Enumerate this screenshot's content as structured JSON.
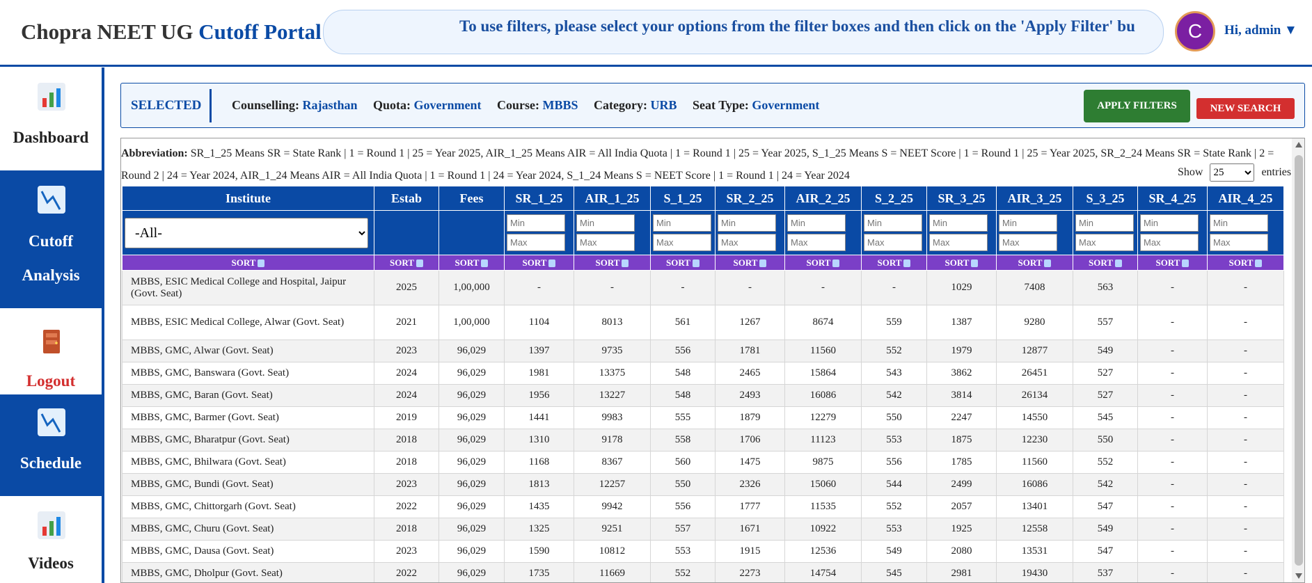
{
  "header": {
    "brand_main": "Chopra NEET UG",
    "brand_accent": "Cutoff Portal",
    "notice": "To use filters, please select your options from the filter boxes and then click on the 'Apply Filter' bu",
    "avatar_letter": "C",
    "greeting": "Hi, admin ▼"
  },
  "sidebar": {
    "items": [
      {
        "label": "Dashboard",
        "icon": "bar-chart-icon"
      },
      {
        "label": "Cutoff",
        "label2": "Analysis",
        "icon": "line-chart-icon"
      },
      {
        "label": "Logout",
        "icon": "door-icon"
      },
      {
        "label": "Schedule",
        "icon": "line-chart-icon"
      },
      {
        "label": "Videos",
        "icon": "bar-chart-icon"
      }
    ]
  },
  "selected": {
    "title": "SELECTED",
    "counselling_label": "Counselling:",
    "counselling": "Rajasthan",
    "quota_label": "Quota:",
    "quota": "Government",
    "course_label": "Course:",
    "course": "MBBS",
    "category_label": "Category:",
    "category": "URB",
    "seat_label": "Seat Type:",
    "seat": "Government",
    "apply": "APPLY FILTERS",
    "new_search": "NEW SEARCH"
  },
  "abbreviation": {
    "label": "Abbreviation:",
    "text": "SR_1_25 Means SR = State Rank | 1 = Round 1 | 25 = Year 2025, AIR_1_25 Means AIR = All India Quota | 1 = Round 1 | 25 = Year 2025, S_1_25 Means S = NEET Score | 1 = Round 1 | 25 = Year 2025, SR_2_24 Means SR = State Rank | 2 = Round 2 | 24 = Year 2024, AIR_1_24 Means AIR = All India Quota | 1 = Round 1 | 24 = Year 2024, S_1_24 Means S = NEET Score | 1 = Round 1 | 24 = Year 2024"
  },
  "show": {
    "label": "Show",
    "value": "25",
    "suffix": "entries"
  },
  "table": {
    "columns": [
      "Institute",
      "Estab",
      "Fees",
      "SR_1_25",
      "AIR_1_25",
      "S_1_25",
      "SR_2_25",
      "AIR_2_25",
      "S_2_25",
      "SR_3_25",
      "AIR_3_25",
      "S_3_25",
      "SR_4_25",
      "AIR_4_25"
    ],
    "institute_filter": "-All-",
    "min_placeholder": "Min",
    "max_placeholder": "Max",
    "sort_label": "SORT",
    "rows": [
      [
        "MBBS, ESIC Medical College and Hospital, Jaipur (Govt. Seat)",
        "2025",
        "1,00,000",
        "-",
        "-",
        "-",
        "-",
        "-",
        "-",
        "1029",
        "7408",
        "563",
        "-",
        "-"
      ],
      [
        "MBBS, ESIC Medical College, Alwar (Govt. Seat)",
        "2021",
        "1,00,000",
        "1104",
        "8013",
        "561",
        "1267",
        "8674",
        "559",
        "1387",
        "9280",
        "557",
        "-",
        "-"
      ],
      [
        "MBBS, GMC, Alwar (Govt. Seat)",
        "2023",
        "96,029",
        "1397",
        "9735",
        "556",
        "1781",
        "11560",
        "552",
        "1979",
        "12877",
        "549",
        "-",
        "-"
      ],
      [
        "MBBS, GMC, Banswara (Govt. Seat)",
        "2024",
        "96,029",
        "1981",
        "13375",
        "548",
        "2465",
        "15864",
        "543",
        "3862",
        "26451",
        "527",
        "-",
        "-"
      ],
      [
        "MBBS, GMC, Baran (Govt. Seat)",
        "2024",
        "96,029",
        "1956",
        "13227",
        "548",
        "2493",
        "16086",
        "542",
        "3814",
        "26134",
        "527",
        "-",
        "-"
      ],
      [
        "MBBS, GMC, Barmer (Govt. Seat)",
        "2019",
        "96,029",
        "1441",
        "9983",
        "555",
        "1879",
        "12279",
        "550",
        "2247",
        "14550",
        "545",
        "-",
        "-"
      ],
      [
        "MBBS, GMC, Bharatpur (Govt. Seat)",
        "2018",
        "96,029",
        "1310",
        "9178",
        "558",
        "1706",
        "11123",
        "553",
        "1875",
        "12230",
        "550",
        "-",
        "-"
      ],
      [
        "MBBS, GMC, Bhilwara (Govt. Seat)",
        "2018",
        "96,029",
        "1168",
        "8367",
        "560",
        "1475",
        "9875",
        "556",
        "1785",
        "11560",
        "552",
        "-",
        "-"
      ],
      [
        "MBBS, GMC, Bundi (Govt. Seat)",
        "2023",
        "96,029",
        "1813",
        "12257",
        "550",
        "2326",
        "15060",
        "544",
        "2499",
        "16086",
        "542",
        "-",
        "-"
      ],
      [
        "MBBS, GMC, Chittorgarh (Govt. Seat)",
        "2022",
        "96,029",
        "1435",
        "9942",
        "556",
        "1777",
        "11535",
        "552",
        "2057",
        "13401",
        "547",
        "-",
        "-"
      ],
      [
        "MBBS, GMC, Churu (Govt. Seat)",
        "2018",
        "96,029",
        "1325",
        "9251",
        "557",
        "1671",
        "10922",
        "553",
        "1925",
        "12558",
        "549",
        "-",
        "-"
      ],
      [
        "MBBS, GMC, Dausa (Govt. Seat)",
        "2023",
        "96,029",
        "1590",
        "10812",
        "553",
        "1915",
        "12536",
        "549",
        "2080",
        "13531",
        "547",
        "-",
        "-"
      ],
      [
        "MBBS, GMC, Dholpur (Govt. Seat)",
        "2022",
        "96,029",
        "1735",
        "11669",
        "552",
        "2273",
        "14754",
        "545",
        "2981",
        "19430",
        "537",
        "-",
        "-"
      ]
    ]
  },
  "colors": {
    "primary": "#0a4aa5",
    "sort_bar": "#7b3fc7",
    "apply": "#2e7d32",
    "new": "#d32f2f"
  }
}
